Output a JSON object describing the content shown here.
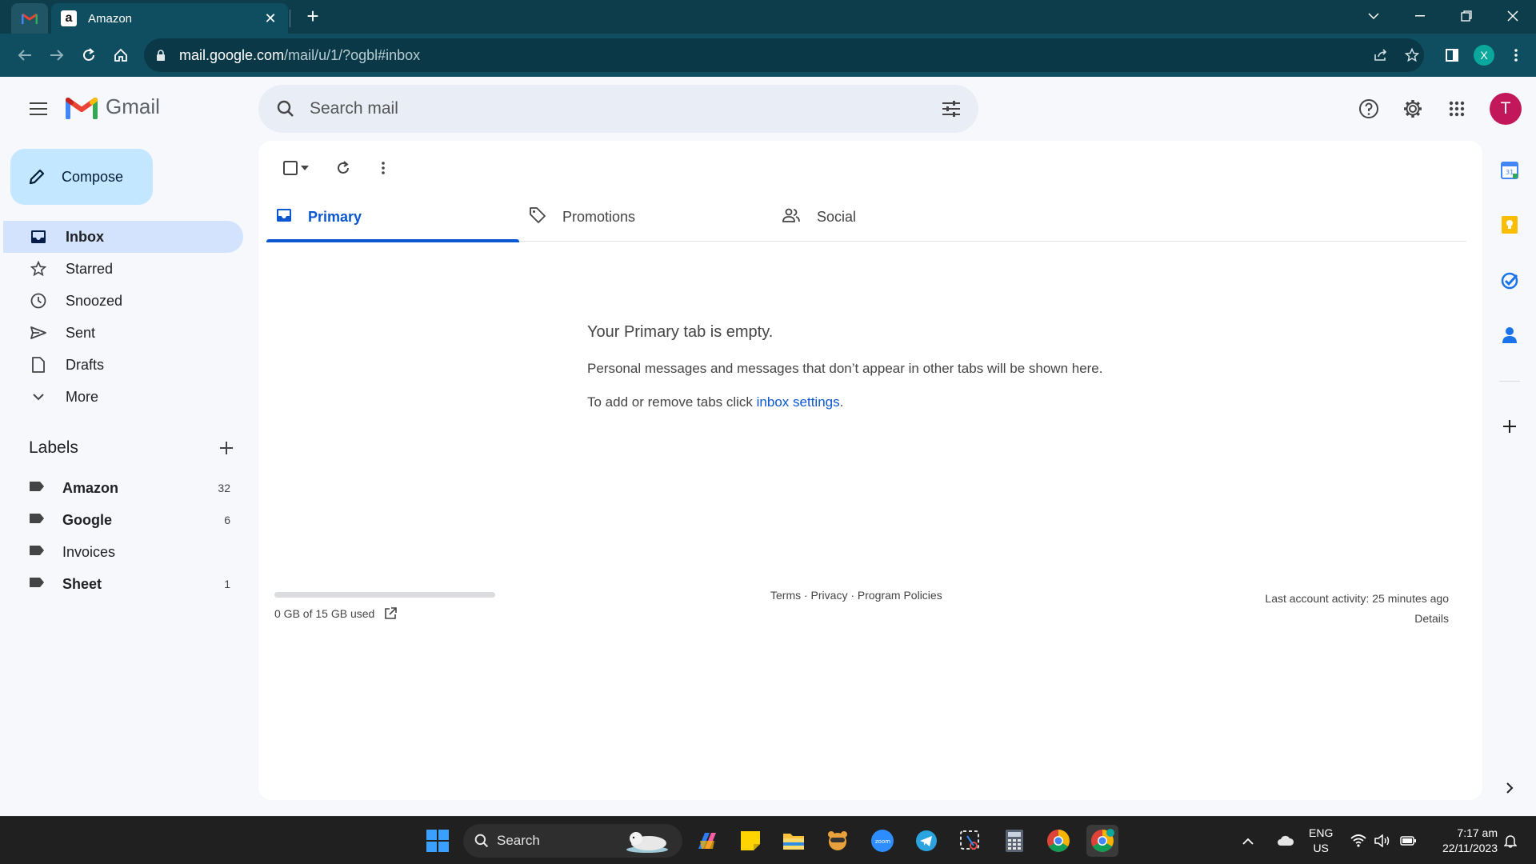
{
  "browser": {
    "tab_title": "Amazon",
    "url_host": "mail.google.com",
    "url_path": "/mail/u/1/?ogbl#inbox",
    "profile_initial": "X"
  },
  "header": {
    "app_name": "Gmail",
    "search_placeholder": "Search mail",
    "avatar_initial": "T"
  },
  "sidebar": {
    "compose_label": "Compose",
    "items": [
      {
        "label": "Inbox",
        "icon": "inbox-icon",
        "active": true
      },
      {
        "label": "Starred",
        "icon": "star-icon"
      },
      {
        "label": "Snoozed",
        "icon": "clock-icon"
      },
      {
        "label": "Sent",
        "icon": "send-icon"
      },
      {
        "label": "Drafts",
        "icon": "draft-icon"
      },
      {
        "label": "More",
        "icon": "chevron-down-icon"
      }
    ],
    "labels_title": "Labels",
    "labels": [
      {
        "name": "Amazon",
        "count": "32",
        "bold": true
      },
      {
        "name": "Google",
        "count": "6",
        "bold": true
      },
      {
        "name": "Invoices",
        "count": "",
        "bold": false
      },
      {
        "name": "Sheet",
        "count": "1",
        "bold": true
      }
    ]
  },
  "main": {
    "tabs": [
      {
        "label": "Primary",
        "icon": "inbox-icon",
        "selected": true
      },
      {
        "label": "Promotions",
        "icon": "tag-icon",
        "selected": false
      },
      {
        "label": "Social",
        "icon": "people-icon",
        "selected": false
      }
    ],
    "empty_title": "Your Primary tab is empty.",
    "empty_desc": "Personal messages and messages that don’t appear in other tabs will be shown here.",
    "empty_settings_prefix": "To add or remove tabs click ",
    "empty_settings_link": "inbox settings",
    "empty_settings_suffix": ".",
    "storage_text": "0 GB of 15 GB used",
    "storage_fraction": 0,
    "footer_links": "Terms · Privacy · Program Policies",
    "last_activity": "Last account activity: 25 minutes ago",
    "details_label": "Details"
  },
  "taskbar": {
    "search_label": "Search",
    "lang_line1": "ENG",
    "lang_line2": "US",
    "time": "7:17 am",
    "date": "22/11/2023"
  },
  "colors": {
    "chrome_dark": "#0d3c4a",
    "chrome_toolbar": "#0f4e60",
    "accent_blue": "#0b57d0",
    "compose_bg": "#c2e7ff",
    "nav_active_bg": "#d3e3fd",
    "avatar_bg": "#c2185b"
  }
}
